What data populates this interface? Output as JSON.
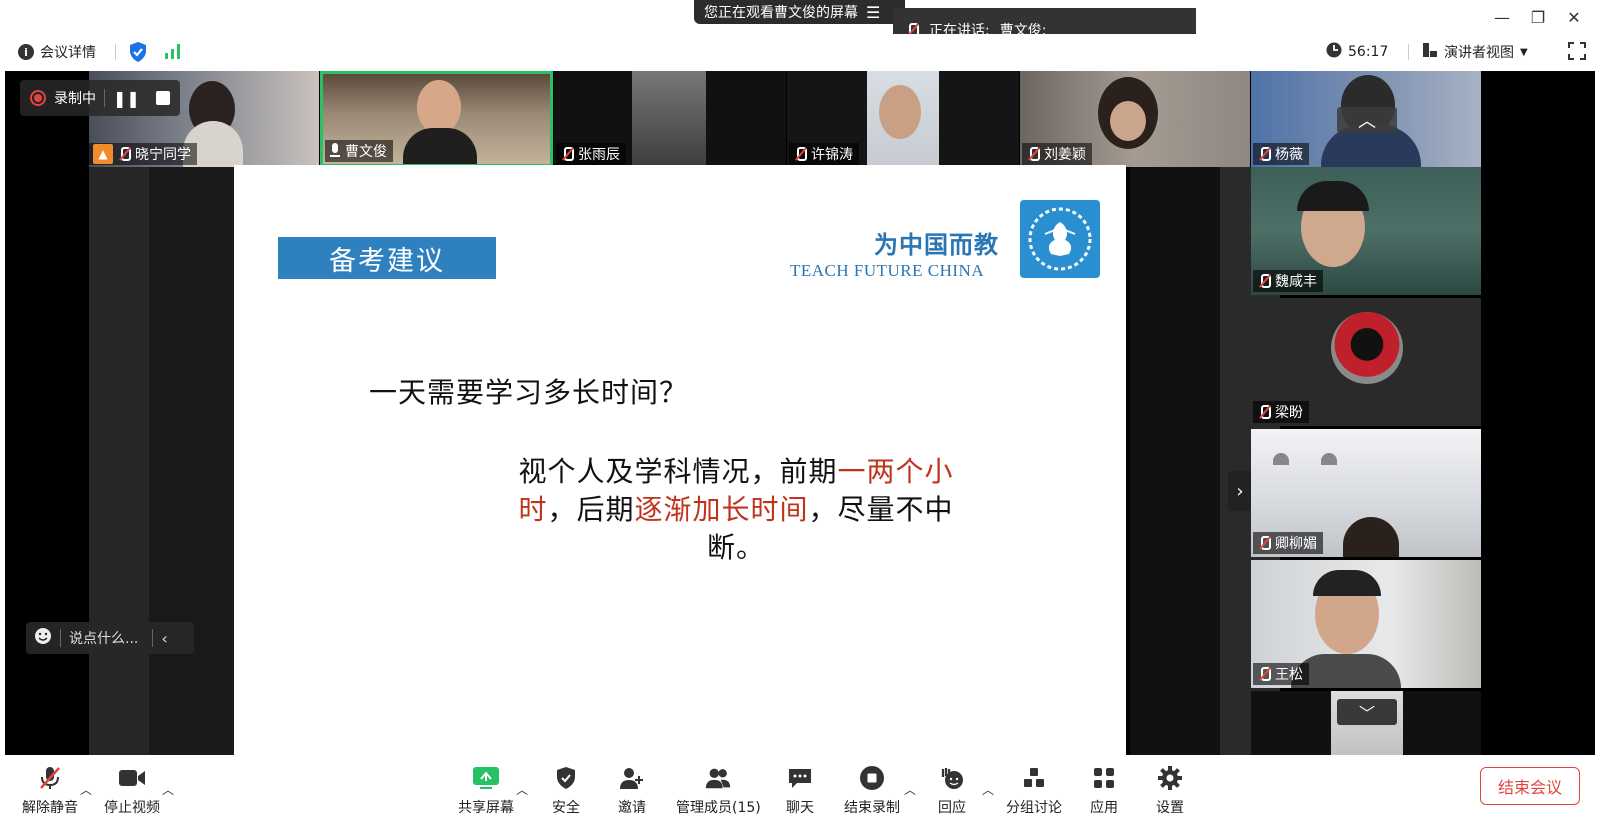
{
  "titlebar": {
    "share_banner": "您正在观看曹文俊的屏幕",
    "speaking_label": "正在讲话:",
    "speaking_name": "曹文俊;"
  },
  "infobar": {
    "meeting_details": "会议详情",
    "timer": "56:17",
    "view_mode": "演讲者视图"
  },
  "recording": {
    "label": "录制中"
  },
  "top_participants": [
    {
      "name": "晓宁同学"
    },
    {
      "name": "曹文俊"
    },
    {
      "name": "张雨辰"
    },
    {
      "name": "许锦涛"
    },
    {
      "name": "刘姜颖"
    },
    {
      "name": "杨薇"
    }
  ],
  "right_participants": [
    {
      "name": "魏咸丰"
    },
    {
      "name": "梁盼"
    },
    {
      "name": "卿柳媚"
    },
    {
      "name": "王松"
    }
  ],
  "slide": {
    "title": "备考建议",
    "brand_cn": "为中国而教",
    "brand_en": "TEACH FUTURE CHINA",
    "question": "一天需要学习多长时间？",
    "answer_part1": "视个人及学科情况，前期",
    "answer_red1": "一两个小时",
    "answer_part2": "，后期",
    "answer_red2": "逐渐加长时间",
    "answer_part3": "，尽量不中断。"
  },
  "chat": {
    "placeholder": "说点什么..."
  },
  "toolbar": {
    "unmute": "解除静音",
    "stop_video": "停止视频",
    "share_screen": "共享屏幕",
    "security": "安全",
    "invite": "邀请",
    "participants": "管理成员(15)",
    "chat": "聊天",
    "end_recording": "结束录制",
    "reactions": "回应",
    "breakout": "分组讨论",
    "apps": "应用",
    "settings": "设置",
    "end_meeting": "结束会议"
  },
  "colors": {
    "accent_blue": "#2e80bf",
    "slide_red": "#c0341e",
    "end_red": "#e0463f",
    "active_speaker": "#27c266"
  }
}
